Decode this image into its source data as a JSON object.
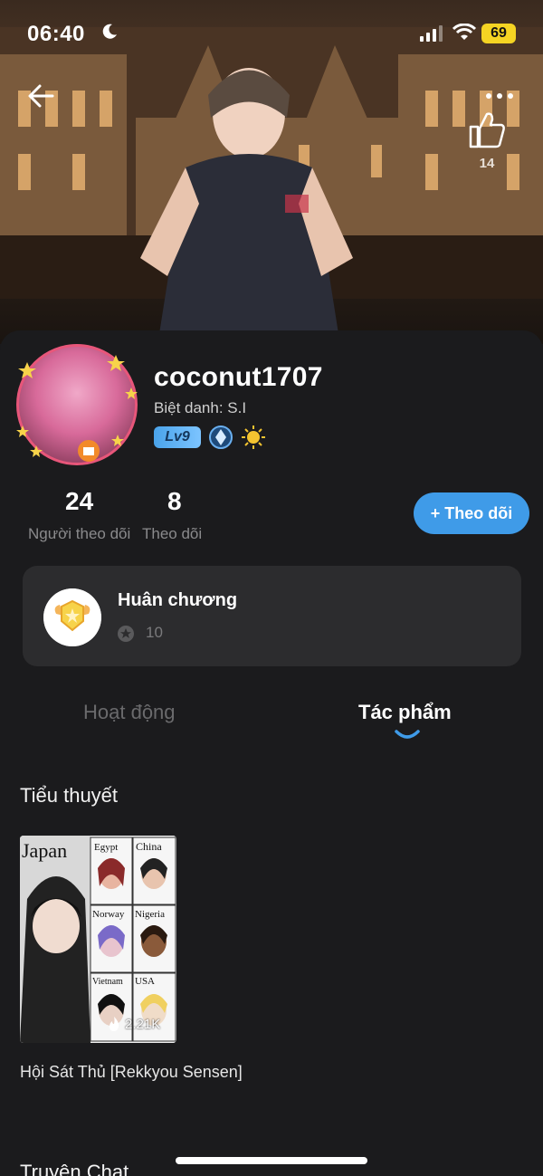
{
  "status_bar": {
    "time": "06:40",
    "battery": "69"
  },
  "header": {
    "like_count": "14"
  },
  "profile": {
    "username": "coconut1707",
    "nickname": "Biệt danh: S.I",
    "level": "Lv9"
  },
  "stats": {
    "followers_value": "24",
    "followers_label": "Người theo dõi",
    "following_value": "8",
    "following_label": "Theo dõi",
    "follow_button": "+ Theo dõi"
  },
  "medals": {
    "title": "Huân chương",
    "count": "10"
  },
  "tabs": {
    "activity": "Hoạt động",
    "works": "Tác phẩm"
  },
  "sections": {
    "novels": "Tiểu thuyết",
    "chat_stories": "Truyện Chat"
  },
  "novel": {
    "views": "2.21K",
    "title": "Hội Sát Thủ [Rekkyou Sensen]",
    "cover_labels": [
      "Japan",
      "Egypt",
      "China",
      "Norway",
      "Nigeria",
      "Vietnam",
      "USA"
    ]
  },
  "colors": {
    "accent": "#3f9be8",
    "background": "#1b1b1d",
    "card": "#2c2c2e",
    "level_badge": "#4aa3ea"
  }
}
